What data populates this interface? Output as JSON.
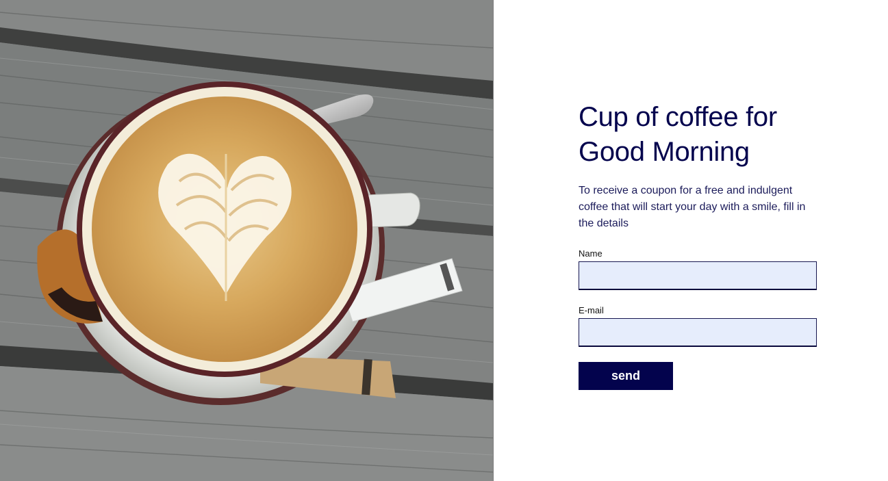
{
  "hero": {
    "title": "Cup of coffee for Good Morning",
    "description": "To receive a coupon for a free and indulgent coffee that will start your day with a smile, fill in the details"
  },
  "form": {
    "name_label": "Name",
    "name_value": "",
    "email_label": "E-mail",
    "email_value": "",
    "submit_label": "send"
  },
  "colors": {
    "accent": "#03034d",
    "input_background": "#e6edfc",
    "page_background": "#ffffff"
  }
}
